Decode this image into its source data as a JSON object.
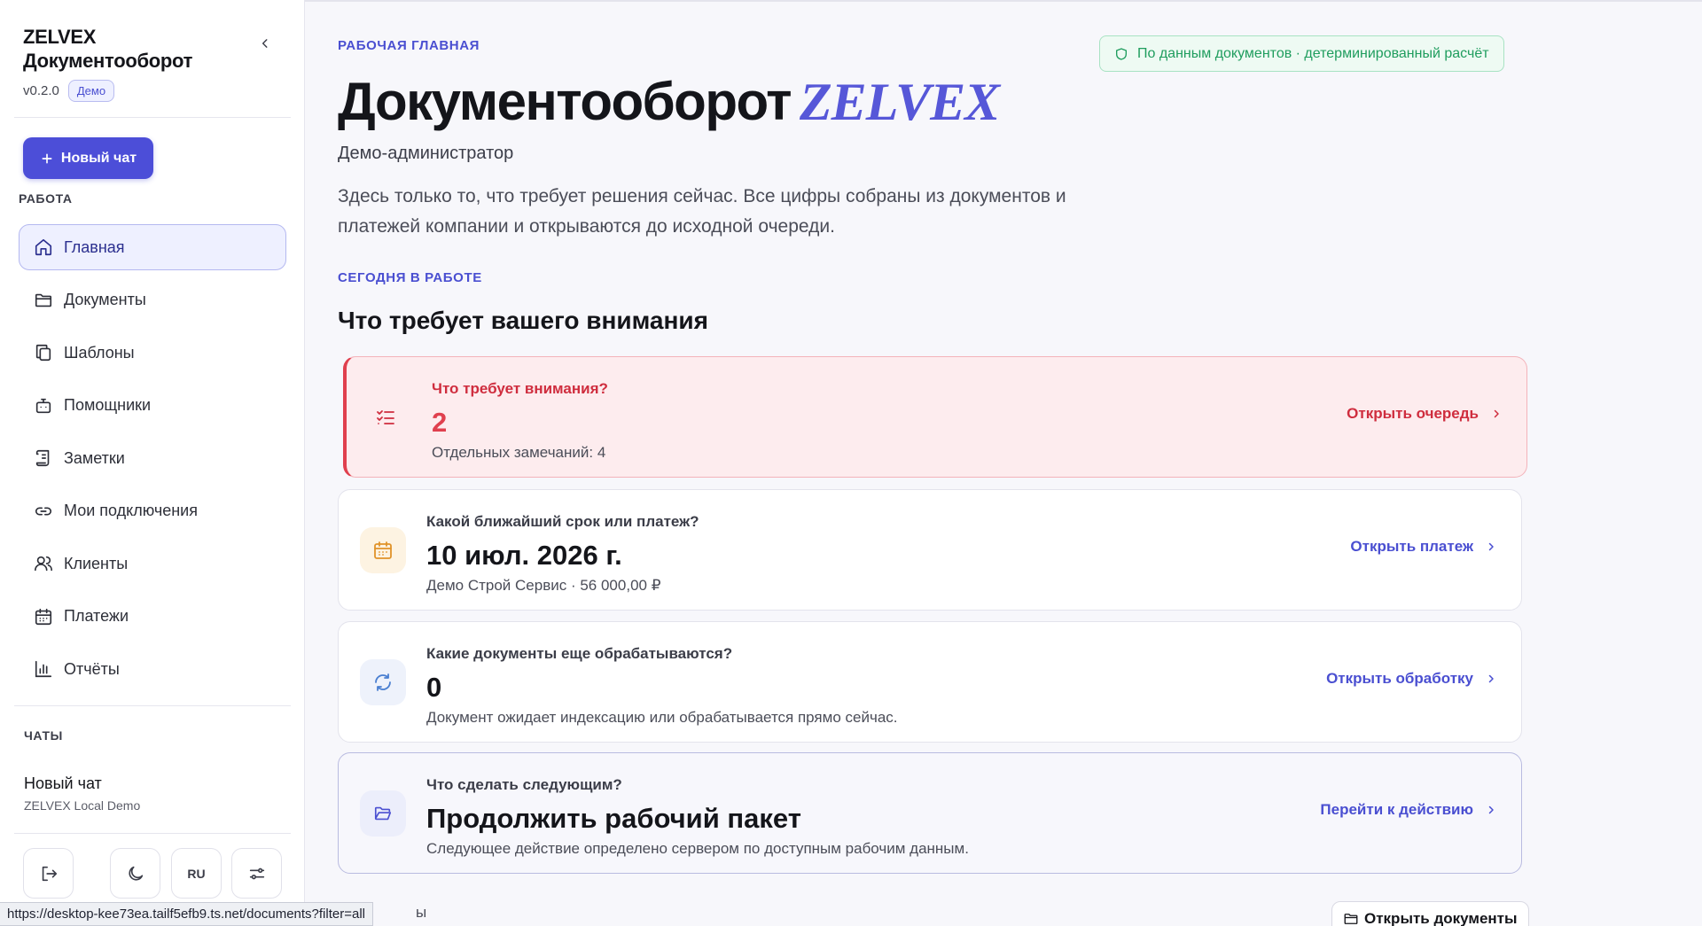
{
  "sidebar": {
    "brand_line1": "ZELVEX",
    "brand_line2": "Документооборот",
    "version": "v0.2.0",
    "badge": "Демо",
    "new_chat": "Новый чат",
    "section_work": "РАБОТА",
    "items": [
      {
        "label": "Главная",
        "icon": "home-icon"
      },
      {
        "label": "Документы",
        "icon": "folder-icon"
      },
      {
        "label": "Шаблоны",
        "icon": "copy-icon"
      },
      {
        "label": "Помощники",
        "icon": "bot-icon"
      },
      {
        "label": "Заметки",
        "icon": "scroll-icon"
      },
      {
        "label": "Мои подключения",
        "icon": "link-icon"
      },
      {
        "label": "Клиенты",
        "icon": "users-icon"
      },
      {
        "label": "Платежи",
        "icon": "calendar-icon"
      },
      {
        "label": "Отчёты",
        "icon": "bar-chart-icon"
      }
    ],
    "section_chats": "ЧАТЫ",
    "chat": {
      "title": "Новый чат",
      "subtitle": "ZELVEX Local Demo"
    },
    "lang": "RU"
  },
  "status_url": "https://desktop-kee73ea.tailf5efb9.ts.net/documents?filter=all",
  "main": {
    "eyebrow": "РАБОЧАЯ ГЛАВНАЯ",
    "title": "Документооборот",
    "title_brand": "ZELVEX",
    "subtitle": "Демо-администратор",
    "lead": "Здесь только то, что требует решения сейчас. Все цифры собраны из документов и платежей компании и открываются до исходной очереди.",
    "badge": "По данным документов · детерминированный расчёт",
    "today_label": "СЕГОДНЯ В РАБОТЕ",
    "heading": "Что требует вашего внимания",
    "cards": [
      {
        "question": "Что требует внимания?",
        "value": "2",
        "sub": "Отдельных замечаний: 4",
        "link": "Открыть очередь",
        "icon": "checklist-icon"
      },
      {
        "question": "Какой ближайший срок или платеж?",
        "value": "10 июл. 2026 г.",
        "sub": "Демо Строй Сервис · 56 000,00 ₽",
        "link": "Открыть платеж",
        "icon": "calendar-icon"
      },
      {
        "question": "Какие документы еще обрабатываются?",
        "value": "0",
        "sub": "Документ ожидает индексацию или обрабатывается прямо сейчас.",
        "link": "Открыть обработку",
        "icon": "refresh-icon"
      },
      {
        "question": "Что сделать следующим?",
        "value": "Продолжить рабочий пакет",
        "sub": "Следующее действие определено сервером по доступным рабочим данным.",
        "link": "Перейти к действию",
        "icon": "folder-open-icon"
      }
    ],
    "bottom_partial": "ы",
    "open_docs": "Открыть документы"
  }
}
